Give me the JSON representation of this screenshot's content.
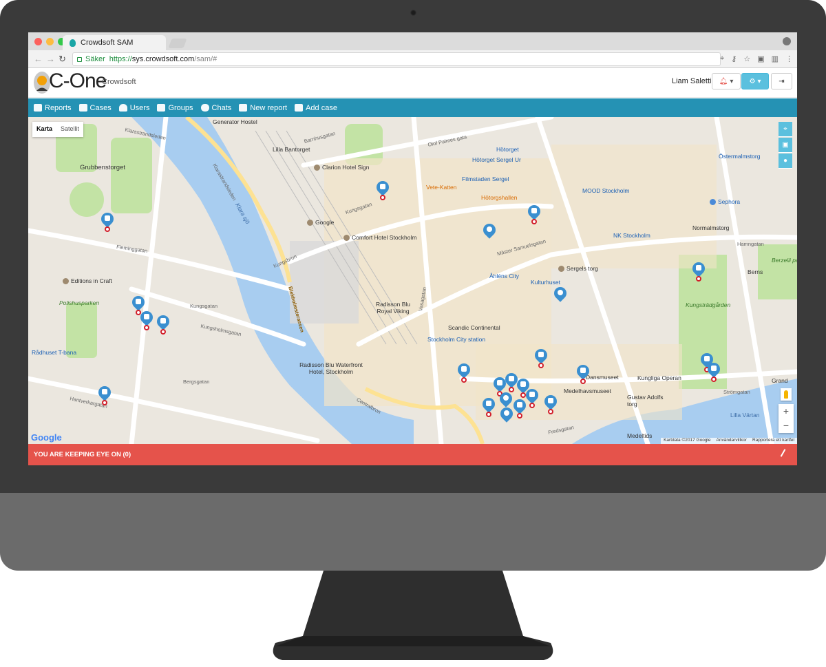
{
  "browser": {
    "tab_title": "Crowdsoft SAM",
    "secure_label": "Säker",
    "url_scheme": "https://",
    "url_host": "sys.crowdsoft.com",
    "url_path": "/sam/#"
  },
  "header": {
    "logo_text": "C-One",
    "brand": "Crowdsoft",
    "user": "Liam Saletti"
  },
  "nav": [
    {
      "label": "Reports",
      "icon": "reports-icon"
    },
    {
      "label": "Cases",
      "icon": "cases-icon"
    },
    {
      "label": "Users",
      "icon": "users-icon"
    },
    {
      "label": "Groups",
      "icon": "groups-icon"
    },
    {
      "label": "Chats",
      "icon": "chats-icon"
    },
    {
      "label": "New report",
      "icon": "new-report-icon"
    },
    {
      "label": "Add case",
      "icon": "add-case-icon"
    }
  ],
  "map": {
    "type_map": "Karta",
    "type_satellite": "Satellit",
    "attribution": [
      "Kartdata ©2017 Google",
      "Användarvillkor",
      "Rapportera ett kartfel"
    ],
    "google": "Google",
    "places": {
      "generator": "Generator Hostel",
      "lilla_bantorget": "Lilla Bantorget",
      "clarion": "Clarion Hotel Sign",
      "vete": "Vete-Katten",
      "hotorget": "Hötorget Sergel Ur",
      "filmstaden": "Filmstaden Sergel",
      "hotorgshallen": "Hötorgshallen",
      "mood": "MOOD Stockholm",
      "sephora": "Sephora",
      "google_office": "Google",
      "comfort": "Comfort Hotel Stockholm",
      "normalm": "Normalmstorg",
      "nk": "NK Stockholm",
      "grubbens": "Grubbenstorget",
      "editions": "Editions in Craft",
      "polishus": "Polishusparken",
      "radhuset": "Rådhuset T-bana",
      "ahlens": "Åhléns City",
      "sergels": "Sergels torg",
      "kulturhuset": "Kulturhuset",
      "berns": "Berns",
      "berzelii": "Berzelii park",
      "radisson_rv": "Radisson Blu Royal Viking",
      "scandic": "Scandic Continental",
      "stockholm_c": "Stockholm City station",
      "kungstradgarden": "Kungsträdgården",
      "radisson_wf": "Radisson Blu Waterfront Hotel, Stockholm",
      "dansmuseet": "Dansmuseet",
      "operan": "Kungliga Operan",
      "medelhav": "Medelhavsmuseet",
      "gustav": "Gustav Adolfs torg",
      "lilla_vartan": "Lilla Värtan",
      "medeltids": "Medeltids",
      "grand": "Grand",
      "hotorget_t": "Hötorget",
      "ostermalm": "Östermalmstorg",
      "klara": "Klara sjö"
    },
    "streets": {
      "klarastrand": "Klarastrandsleden",
      "kungsgatan": "Kungsgatan",
      "hamngatan": "Hamngatan",
      "vasagatan": "Vasagatan",
      "kungsholmsgatan": "Kungsholmsgatan",
      "fleminggatan": "Fleminggatan",
      "hantverkargatan": "Hantverkargatan",
      "centralbron": "Centralbron",
      "strömgatan": "Strömgatan",
      "olof_palmes": "Olof Palmes gata",
      "master_samuels": "Mäster Samuelsgatan",
      "barnhusgatan": "Barnhusgatan",
      "kungsbron": "Kungsbron",
      "bergsgatan": "Bergsgatan",
      "fredsgatan": "Fredsgatan",
      "blekholm": "Blekholmsterassen"
    }
  },
  "footer": {
    "watch_text": "YOU ARE KEEPING EYE ON (0)"
  },
  "colors": {
    "nav": "#2592b4",
    "accent": "#5bc0de",
    "marker": "#3a8fd0",
    "alert_bar": "#e5534b",
    "water": "#a8cdf0",
    "park": "#c3e3a5"
  }
}
